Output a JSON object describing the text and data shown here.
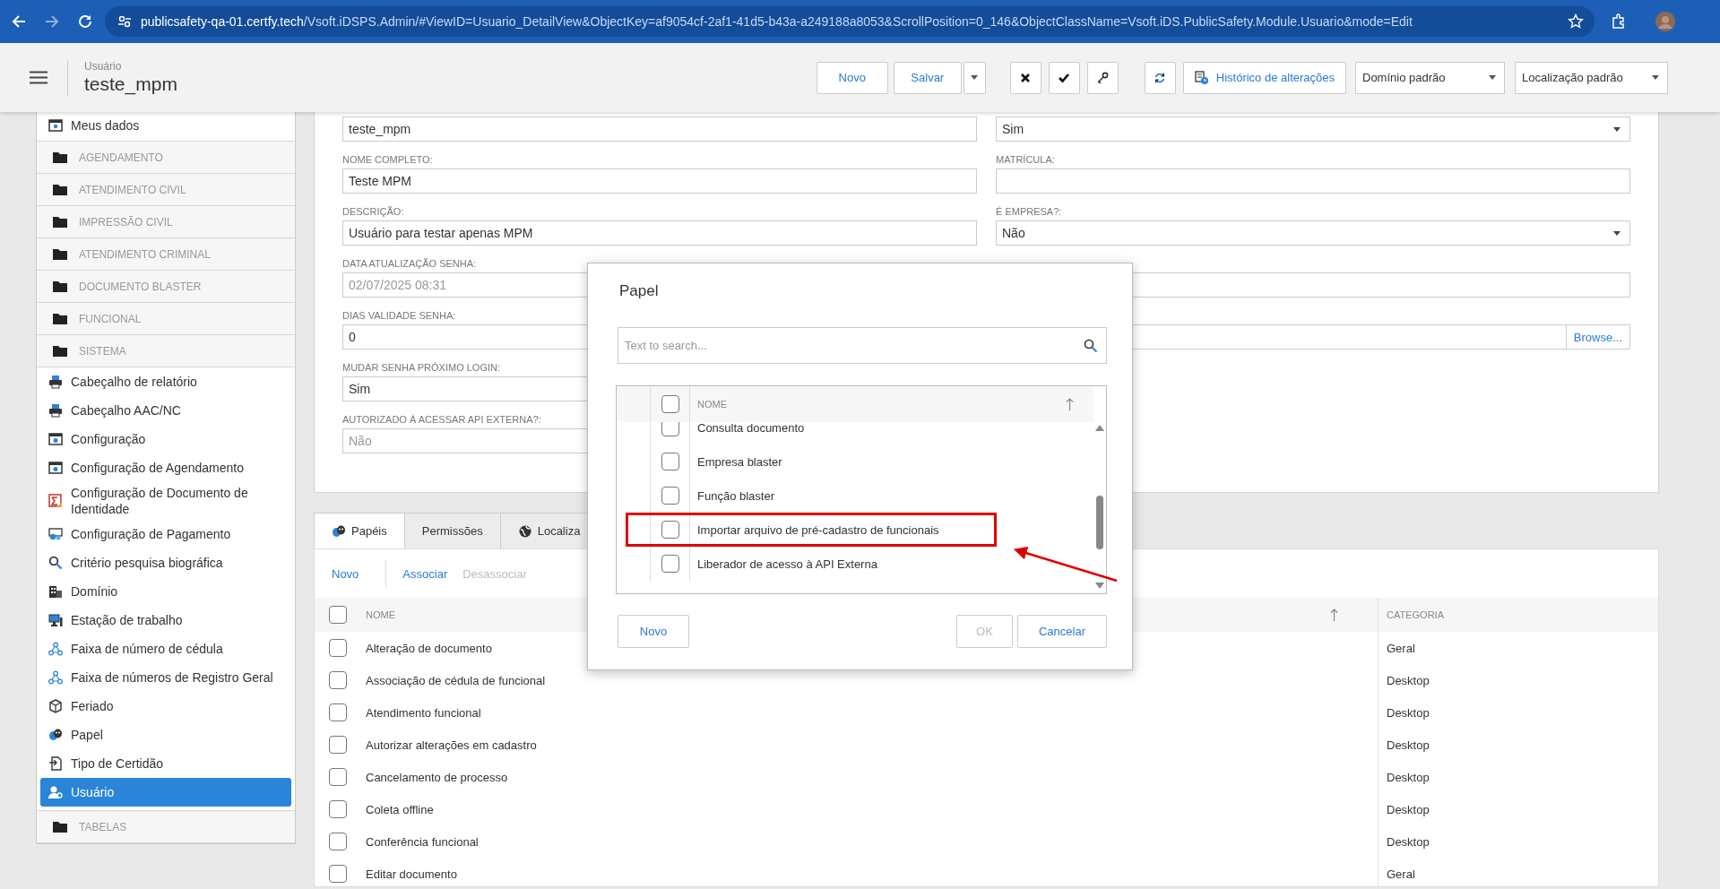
{
  "browser": {
    "url_host": "publicsafety-qa-01.certfy.tech",
    "url_path": "/Vsoft.iDSPS.Admin/#ViewID=Usuario_DetailView&ObjectKey=af9054cf-2af1-41d5-b43a-a249188a8053&ScrollPosition=0_146&ObjectClassName=Vsoft.iDS.PublicSafety.Module.Usuario&mode=Edit"
  },
  "header": {
    "subtitle": "Usuário",
    "title": "teste_mpm",
    "button_groups": [
      [
        {
          "kind": "text",
          "label": "Novo"
        },
        {
          "kind": "split",
          "label": "Salvar"
        }
      ],
      [
        {
          "kind": "icon"
        },
        {
          "kind": "icon"
        },
        {
          "kind": "icon"
        }
      ],
      [
        {
          "kind": "icon"
        },
        {
          "kind": "icon-text",
          "label": "Histórico de alterações"
        }
      ]
    ],
    "selects": [
      {
        "value": "Domínio padrão"
      },
      {
        "value": "Localização padrão"
      }
    ]
  },
  "sidebar": {
    "items": [
      {
        "kind": "item",
        "label": "Meus dados",
        "selected": false
      },
      {
        "kind": "group",
        "label": "AGENDAMENTO",
        "selected": false
      },
      {
        "kind": "group",
        "label": "ATENDIMENTO CIVIL",
        "selected": false
      },
      {
        "kind": "group",
        "label": "IMPRESSÃO CIVIL",
        "selected": false
      },
      {
        "kind": "group",
        "label": "ATENDIMENTO CRIMINAL",
        "selected": false
      },
      {
        "kind": "group",
        "label": "DOCUMENTO BLASTER",
        "selected": false
      },
      {
        "kind": "group",
        "label": "FUNCIONAL",
        "selected": false
      },
      {
        "kind": "group",
        "label": "SISTEMA",
        "selected": false
      },
      {
        "kind": "item",
        "label": "Cabeçalho de relatório",
        "selected": false
      },
      {
        "kind": "item",
        "label": "Cabeçalho AAC/NC",
        "selected": false
      },
      {
        "kind": "item",
        "label": "Configuração",
        "selected": false
      },
      {
        "kind": "item",
        "label": "Configuração de Agendamento",
        "selected": false
      },
      {
        "kind": "item",
        "label": "Configuração de Documento de Identidade",
        "selected": false
      },
      {
        "kind": "item",
        "label": "Configuração de Pagamento",
        "selected": false
      },
      {
        "kind": "item",
        "label": "Critério pesquisa biográfica",
        "selected": false
      },
      {
        "kind": "item",
        "label": "Domínio",
        "selected": false
      },
      {
        "kind": "item",
        "label": "Estação de trabalho",
        "selected": false
      },
      {
        "kind": "item",
        "label": "Faixa de número de cédula",
        "selected": false
      },
      {
        "kind": "item",
        "label": "Faixa de números de Registro Geral",
        "selected": false
      },
      {
        "kind": "item",
        "label": "Feriado",
        "selected": false
      },
      {
        "kind": "item",
        "label": "Papel",
        "selected": false
      },
      {
        "kind": "item",
        "label": "Tipo de Certidão",
        "selected": false
      },
      {
        "kind": "item",
        "label": "Usuário",
        "selected": true
      },
      {
        "kind": "group",
        "label": "TABELAS",
        "selected": false
      }
    ]
  },
  "form": {
    "left": [
      {
        "kind": "text",
        "value": "teste_mpm",
        "disabled": false
      },
      {
        "kind": "text",
        "label": "NOME COMPLETO:",
        "value": "Teste MPM",
        "disabled": false
      },
      {
        "kind": "text",
        "label": "DESCRIÇÃO:",
        "value": "Usuário para testar apenas MPM",
        "disabled": false
      },
      {
        "kind": "text",
        "label": "DATA ATUALIZAÇÃO SENHA:",
        "value": "02/07/2025 08:31",
        "disabled": true
      },
      {
        "kind": "text",
        "label": "DIAS VALIDADE SENHA:",
        "value": "0",
        "disabled": false
      },
      {
        "kind": "text",
        "label": "MUDAR SENHA PRÓXIMO LOGIN:",
        "value": "Sim",
        "disabled": false
      },
      {
        "kind": "text",
        "label": "AUTORIZADO À ACESSAR API EXTERNA?:",
        "value": "Não",
        "disabled": true
      }
    ],
    "right": [
      {
        "kind": "select",
        "value": "Sim"
      },
      {
        "kind": "text",
        "label": "MATRÍCULA:"
      },
      {
        "kind": "select",
        "label": "É EMPRESA?:",
        "value": "Não"
      },
      {
        "kind": "text"
      },
      {
        "kind": "file",
        "button": "Browse..."
      }
    ]
  },
  "tabs": [
    {
      "label": "Papéis",
      "selected": true
    },
    {
      "label": "Permissões",
      "selected": false
    },
    {
      "label": "Localiza",
      "selected": false
    }
  ],
  "toolbar": [
    {
      "label": "Novo",
      "disabled": false
    },
    {
      "label": "Associar",
      "disabled": false
    },
    {
      "label": "Desassociar",
      "disabled": true
    }
  ],
  "table": {
    "columns": [
      "NOME",
      "CATEGORIA"
    ],
    "all_checked": false,
    "rows": [
      {
        "name": "Alteração de documento",
        "category": "Geral",
        "checked": false
      },
      {
        "name": "Associação de cédula de funcional",
        "category": "Desktop",
        "checked": false
      },
      {
        "name": "Atendimento funcional",
        "category": "Desktop",
        "checked": false
      },
      {
        "name": "Autorizar alterações em cadastro",
        "category": "Desktop",
        "checked": false
      },
      {
        "name": "Cancelamento de processo",
        "category": "Desktop",
        "checked": false
      },
      {
        "name": "Coleta offline",
        "category": "Desktop",
        "checked": false
      },
      {
        "name": "Conferência funcional",
        "category": "Desktop",
        "checked": false
      },
      {
        "name": "Editar documento",
        "category": "Geral",
        "checked": false
      }
    ]
  },
  "dialog": {
    "title": "Papel",
    "search": {
      "placeholder": "Text to search..."
    },
    "grid": {
      "column": "NOME",
      "all_checked": false,
      "rows": [
        {
          "name": "Consulta documento",
          "checked": false,
          "highlighted": false
        },
        {
          "name": "Empresa blaster",
          "checked": false,
          "highlighted": false
        },
        {
          "name": "Função blaster",
          "checked": false,
          "highlighted": false
        },
        {
          "name": "Importar arquivo de pré-cadastro de funcionais",
          "checked": false,
          "highlighted": true
        },
        {
          "name": "Liberador de acesso à API Externa",
          "checked": false,
          "highlighted": false
        }
      ]
    },
    "buttons": [
      {
        "label": "Novo",
        "disabled": false
      },
      {
        "label": "OK",
        "disabled": true
      },
      {
        "label": "Cancelar",
        "disabled": false
      }
    ]
  }
}
